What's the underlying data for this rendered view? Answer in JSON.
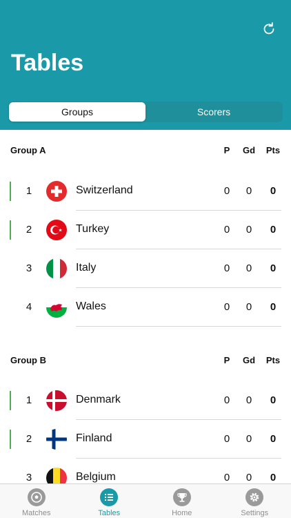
{
  "header": {
    "title": "Tables",
    "refresh_icon": "refresh-icon",
    "background_color": "#1a9aa8"
  },
  "segments": [
    {
      "label": "Groups",
      "active": true
    },
    {
      "label": "Scorers",
      "active": false
    }
  ],
  "groups": [
    {
      "name": "Group A",
      "col_p": "P",
      "col_gd": "Gd",
      "col_pts": "Pts",
      "rows": [
        {
          "pos": "1",
          "team": "Switzerland",
          "flag": "switzerland-flag-icon",
          "p": "0",
          "gd": "0",
          "pts": "0",
          "qualifies": true
        },
        {
          "pos": "2",
          "team": "Turkey",
          "flag": "turkey-flag-icon",
          "p": "0",
          "gd": "0",
          "pts": "0",
          "qualifies": true
        },
        {
          "pos": "3",
          "team": "Italy",
          "flag": "italy-flag-icon",
          "p": "0",
          "gd": "0",
          "pts": "0",
          "qualifies": false
        },
        {
          "pos": "4",
          "team": "Wales",
          "flag": "wales-flag-icon",
          "p": "0",
          "gd": "0",
          "pts": "0",
          "qualifies": false
        }
      ]
    },
    {
      "name": "Group B",
      "col_p": "P",
      "col_gd": "Gd",
      "col_pts": "Pts",
      "rows": [
        {
          "pos": "1",
          "team": "Denmark",
          "flag": "denmark-flag-icon",
          "p": "0",
          "gd": "0",
          "pts": "0",
          "qualifies": true
        },
        {
          "pos": "2",
          "team": "Finland",
          "flag": "finland-flag-icon",
          "p": "0",
          "gd": "0",
          "pts": "0",
          "qualifies": true
        },
        {
          "pos": "3",
          "team": "Belgium",
          "flag": "belgium-flag-icon",
          "p": "0",
          "gd": "0",
          "pts": "0",
          "qualifies": false
        }
      ]
    }
  ],
  "tabbar": [
    {
      "label": "Matches",
      "icon": "soccer-ball-icon",
      "active": false
    },
    {
      "label": "Tables",
      "icon": "list-icon",
      "active": true
    },
    {
      "label": "Home",
      "icon": "trophy-icon",
      "active": false
    },
    {
      "label": "Settings",
      "icon": "gear-icon",
      "active": false
    }
  ],
  "colors": {
    "accent": "#1a9aa8",
    "qualify_bar": "#4caf50",
    "inactive_tab": "#9a9a9a"
  }
}
